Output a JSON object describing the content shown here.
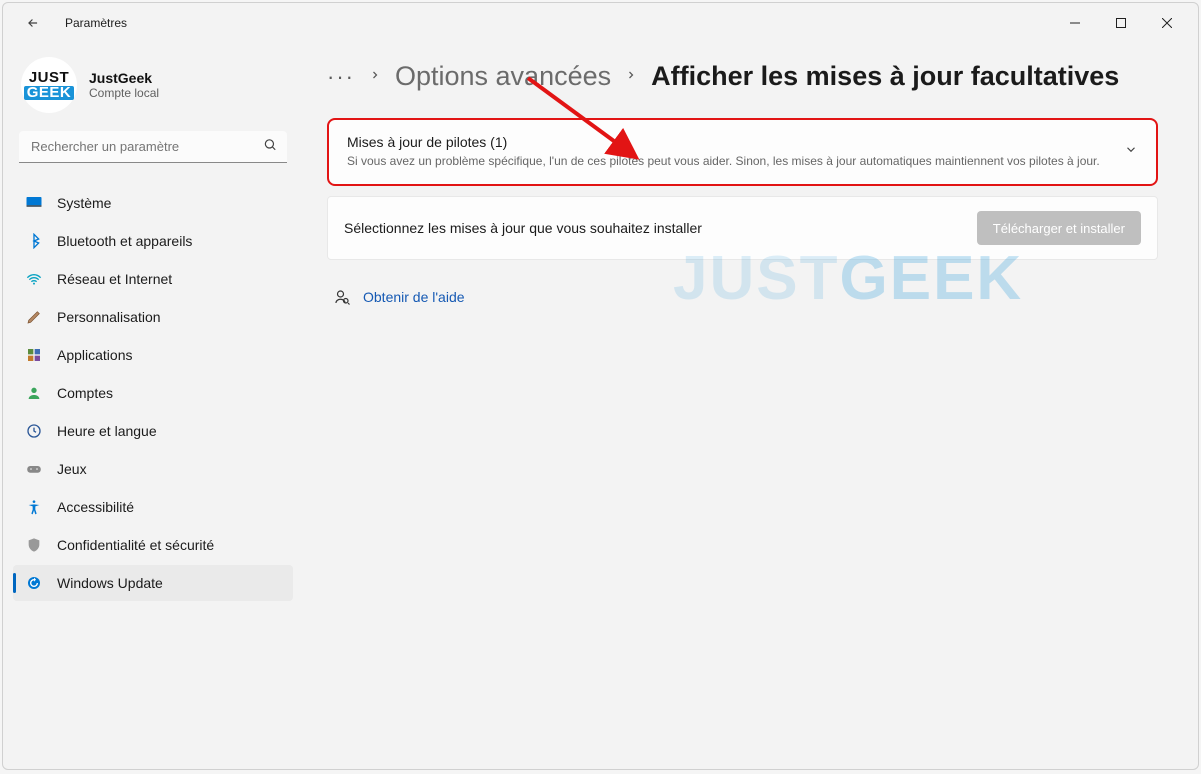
{
  "window": {
    "title": "Paramètres"
  },
  "account": {
    "avatar_line1": "JUST",
    "avatar_line2": "GEEK",
    "name": "JustGeek",
    "subtitle": "Compte local"
  },
  "search": {
    "placeholder": "Rechercher un paramètre"
  },
  "sidebar": {
    "items": [
      {
        "icon": "system",
        "label": "Système"
      },
      {
        "icon": "bluetooth",
        "label": "Bluetooth et appareils"
      },
      {
        "icon": "network",
        "label": "Réseau et Internet"
      },
      {
        "icon": "personalize",
        "label": "Personnalisation"
      },
      {
        "icon": "apps",
        "label": "Applications"
      },
      {
        "icon": "accounts",
        "label": "Comptes"
      },
      {
        "icon": "time",
        "label": "Heure et langue"
      },
      {
        "icon": "gaming",
        "label": "Jeux"
      },
      {
        "icon": "access",
        "label": "Accessibilité"
      },
      {
        "icon": "privacy",
        "label": "Confidentialité et sécurité"
      },
      {
        "icon": "update",
        "label": "Windows Update"
      }
    ],
    "active_index": 10
  },
  "breadcrumb": {
    "more": "···",
    "parent": "Options avancées",
    "current": "Afficher les mises à jour facultatives"
  },
  "driver_card": {
    "title": "Mises à jour de pilotes (1)",
    "subtitle": "Si vous avez un problème spécifique, l'un de ces pilotes peut vous aider. Sinon, les mises à jour automatiques maintiennent vos pilotes à jour."
  },
  "select_card": {
    "text": "Sélectionnez les mises à jour que vous souhaitez installer",
    "button": "Télécharger et installer"
  },
  "help": {
    "label": "Obtenir de l'aide"
  },
  "watermark": {
    "part1": "JUST",
    "part2": "GEEK"
  }
}
